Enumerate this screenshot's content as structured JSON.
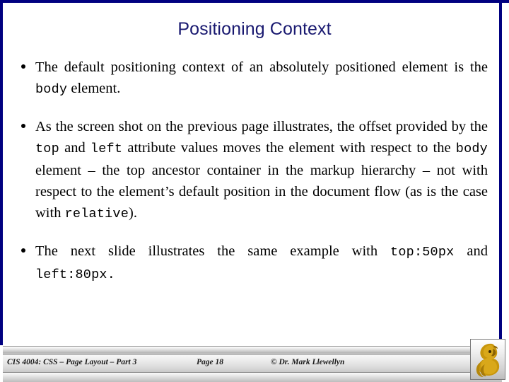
{
  "slide": {
    "title": "Positioning Context",
    "accent_color": "#191970",
    "frame_color": "#000080",
    "background_color": "#ffffff",
    "text_color": "#000000"
  },
  "bullets": [
    {
      "marker": "•",
      "segments": [
        {
          "type": "text",
          "value": "The default positioning context of an absolutely positioned element is the "
        },
        {
          "type": "code",
          "value": "body"
        },
        {
          "type": "text",
          "value": " element."
        }
      ],
      "plain": "The default positioning context of an absolutely positioned element is the body element."
    },
    {
      "marker": "•",
      "segments": [
        {
          "type": "text",
          "value": "As the screen shot on the previous page illustrates, the offset provided by the "
        },
        {
          "type": "code",
          "value": "top"
        },
        {
          "type": "text",
          "value": " and "
        },
        {
          "type": "code",
          "value": "left"
        },
        {
          "type": "text",
          "value": " attribute values moves the element with respect to the "
        },
        {
          "type": "code",
          "value": "body"
        },
        {
          "type": "text",
          "value": " element – the top ancestor container in the markup hierarchy – not with respect to the element’s default position in the document flow (as is the case with "
        },
        {
          "type": "code",
          "value": "relative"
        },
        {
          "type": "text",
          "value": ")."
        }
      ],
      "plain": "As the screen shot on the previous page illustrates, the offset provided by the top and left attribute values moves the element with respect to the body element – the top ancestor container in the markup hierarchy – not with respect to the element’s default position in the document flow (as is the case with relative)."
    },
    {
      "marker": "•",
      "segments": [
        {
          "type": "text",
          "value": "The next slide illustrates the same example with "
        },
        {
          "type": "code",
          "value": "top:50px"
        },
        {
          "type": "text",
          "value": " and "
        },
        {
          "type": "code",
          "value": "left:80px"
        },
        {
          "type": "code",
          "value": "."
        }
      ],
      "plain": "The next slide illustrates the same example with top:50px and left:80px."
    }
  ],
  "footer": {
    "course": "CIS 4004: CSS – Page Layout – Part 3",
    "page": "Page 18",
    "copyright": "© Dr. Mark Llewellyn",
    "logo": "ucf-pegasus-logo",
    "logo_color": "#c8960c"
  }
}
